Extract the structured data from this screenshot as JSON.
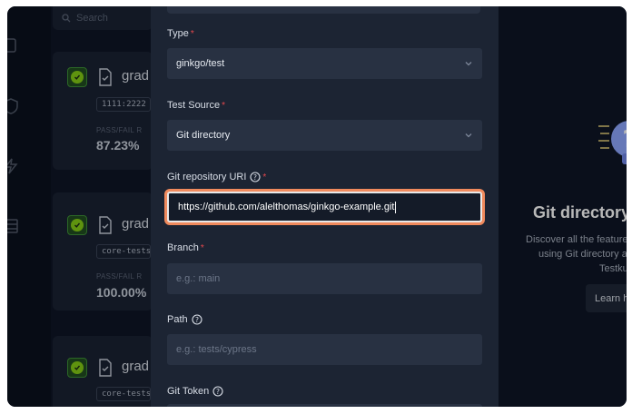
{
  "search": {
    "placeholder": "Search"
  },
  "cards": [
    {
      "name": "grad",
      "tag": "1111:2222",
      "pass_fail_label": "PASS/FAIL R",
      "pass_fail_value": "87.23%"
    },
    {
      "name": "grad",
      "tag": "core-tests:e",
      "pass_fail_label": "PASS/FAIL R",
      "pass_fail_value": "100.00%"
    },
    {
      "name": "grad",
      "tag": "core-tests:e"
    }
  ],
  "form": {
    "type": {
      "label": "Type",
      "value": "ginkgo/test"
    },
    "test_source": {
      "label": "Test Source",
      "value": "Git directory"
    },
    "git_uri": {
      "label": "Git repository URI",
      "value": "https://github.com/alelthomas/ginkgo-example.git"
    },
    "branch": {
      "label": "Branch",
      "placeholder": "e.g.: main"
    },
    "path": {
      "label": "Path",
      "placeholder": "e.g.: tests/cypress"
    },
    "git_token": {
      "label": "Git Token"
    }
  },
  "help": {
    "title": "Git directory",
    "line1": "Discover all the feature",
    "line2": "using Git directory a",
    "line3": "Testku",
    "learn_button": "Learn h"
  },
  "colors": {
    "accent_focus": "#f08a5d",
    "required": "#e5484d",
    "success": "#84cc16"
  }
}
